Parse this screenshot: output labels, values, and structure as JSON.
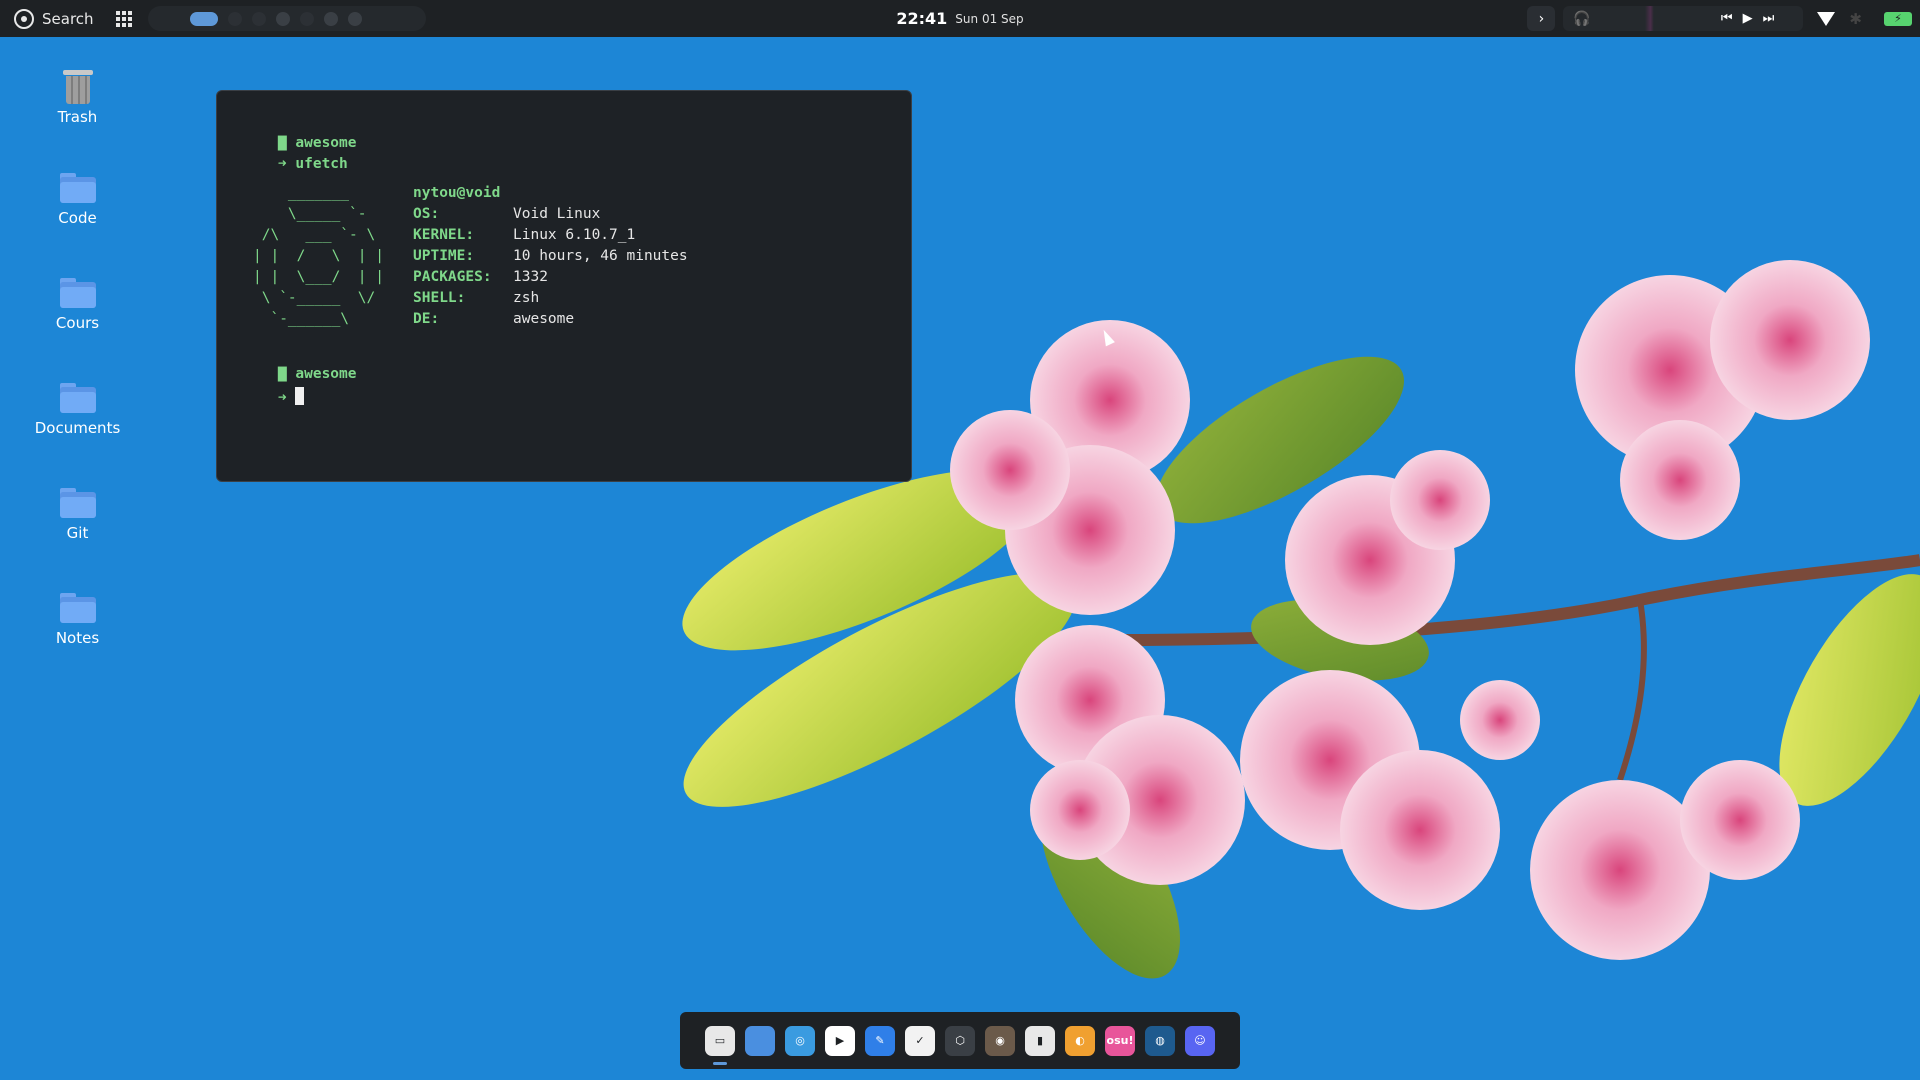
{
  "topbar": {
    "search_label": "Search",
    "time": "22:41",
    "date": "Sun 01 Sep",
    "workspaces": [
      {
        "state": "active"
      },
      {
        "state": "empty"
      },
      {
        "state": "empty"
      },
      {
        "state": "used"
      },
      {
        "state": "empty"
      },
      {
        "state": "used"
      },
      {
        "state": "used"
      }
    ],
    "media_controls": {
      "prev": "⏮",
      "play": "▶",
      "next": "⏭"
    },
    "expand_glyph": "›",
    "battery_glyph": "⚡"
  },
  "desktop_icons": [
    {
      "label": "Trash",
      "icon": "trash-icon"
    },
    {
      "label": "Code",
      "icon": "folder-icon"
    },
    {
      "label": "Cours",
      "icon": "folder-icon"
    },
    {
      "label": "Documents",
      "icon": "folder-icon"
    },
    {
      "label": "Git",
      "icon": "folder-icon"
    },
    {
      "label": "Notes",
      "icon": "folder-icon"
    }
  ],
  "terminal": {
    "dir_label": "awesome",
    "command": "ufetch",
    "prompt_symbol": "➜",
    "user_host": "nytou@void",
    "info": [
      {
        "key": "OS:",
        "value": "Void Linux"
      },
      {
        "key": "KERNEL:",
        "value": "Linux 6.10.7_1"
      },
      {
        "key": "UPTIME:",
        "value": "10 hours, 46 minutes"
      },
      {
        "key": "PACKAGES:",
        "value": "1332"
      },
      {
        "key": "SHELL:",
        "value": "zsh"
      },
      {
        "key": "DE:",
        "value": "awesome"
      }
    ],
    "ascii_art": "    _______\n    \\_____ `-\n /\\   ___ `- \\\n| |  /   \\  | |\n| |  \\___/  | |\n \\ `-_____  \\/\n  `-______\\",
    "dir_label_2": "awesome"
  },
  "dock": [
    {
      "name": "terminal-app",
      "color": "#e8e8e8",
      "glyph": "▭",
      "active": true
    },
    {
      "name": "files-app",
      "color": "#4a8fe0",
      "glyph": "",
      "active": false
    },
    {
      "name": "browser-app",
      "color": "#3a9be0",
      "glyph": "◎",
      "active": false
    },
    {
      "name": "media-player-app",
      "color": "#ffffff",
      "glyph": "▶",
      "active": false
    },
    {
      "name": "text-editor-app",
      "color": "#2f7fe8",
      "glyph": "✎",
      "active": false
    },
    {
      "name": "tasks-app",
      "color": "#f2f2f2",
      "glyph": "✓",
      "active": false
    },
    {
      "name": "godot-app",
      "color": "#3a3f45",
      "glyph": "⬡",
      "active": false
    },
    {
      "name": "gimp-app",
      "color": "#6b5a4a",
      "glyph": "◉",
      "active": false
    },
    {
      "name": "twitch-app",
      "color": "#e8e8e8",
      "glyph": "▮",
      "active": false
    },
    {
      "name": "blender-app",
      "color": "#f0a030",
      "glyph": "◐",
      "active": false
    },
    {
      "name": "osu-app",
      "color": "#e8559a",
      "glyph": "osu!",
      "active": false
    },
    {
      "name": "steam-app",
      "color": "#1e5a8e",
      "glyph": "◍",
      "active": false
    },
    {
      "name": "discord-app",
      "color": "#5865f2",
      "glyph": "☺",
      "active": false
    }
  ]
}
